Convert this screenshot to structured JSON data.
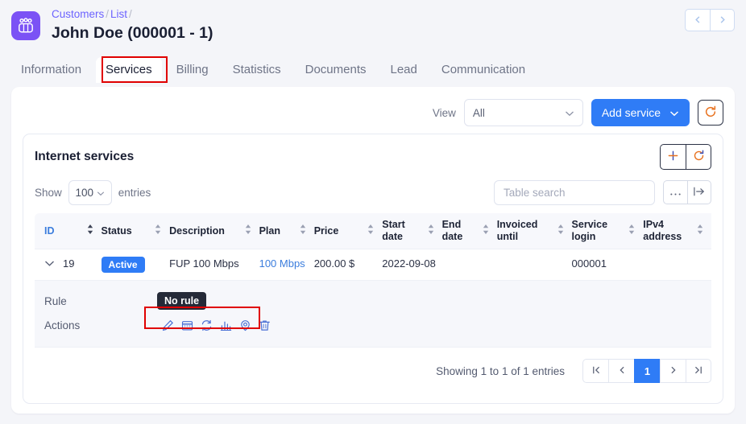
{
  "header": {
    "app_icon": "users-group-icon",
    "breadcrumb": [
      {
        "label": "Customers",
        "link": true
      },
      {
        "label": "List",
        "link": true
      }
    ],
    "title": "John Doe (000001 - 1)",
    "prev_icon": "chevron-left-icon",
    "next_icon": "chevron-right-icon"
  },
  "tabs": [
    {
      "label": "Information",
      "active": false
    },
    {
      "label": "Services",
      "active": true
    },
    {
      "label": "Billing",
      "active": false
    },
    {
      "label": "Statistics",
      "active": false
    },
    {
      "label": "Documents",
      "active": false
    },
    {
      "label": "Lead",
      "active": false
    },
    {
      "label": "Communication",
      "active": false
    }
  ],
  "toolbar": {
    "view_label": "View",
    "view_value": "All",
    "add_service_label": "Add service",
    "refresh_icon": "refresh-icon"
  },
  "panel": {
    "title": "Internet services",
    "add_icon": "plus-icon",
    "refresh_icon": "refresh-icon"
  },
  "table_controls": {
    "show_label": "Show",
    "entries_label": "entries",
    "page_length": "100",
    "search_placeholder": "Table search",
    "search_value": "",
    "more_icon": "ellipsis-icon",
    "export_icon": "export-arrow-icon"
  },
  "table": {
    "columns": [
      {
        "label": "ID",
        "sorted": true
      },
      {
        "label": "Status",
        "sorted": false
      },
      {
        "label": "Description",
        "sorted": false
      },
      {
        "label": "Plan",
        "sorted": false
      },
      {
        "label": "Price",
        "sorted": false
      },
      {
        "label": "Start date",
        "sorted": false
      },
      {
        "label": "End date",
        "sorted": false
      },
      {
        "label": "Invoiced until",
        "sorted": false
      },
      {
        "label": "Service login",
        "sorted": false
      },
      {
        "label": "IPv4 address",
        "sorted": false
      }
    ],
    "rows": [
      {
        "expand_icon": "chevron-down-icon",
        "id": "19",
        "status": "Active",
        "description": "FUP 100 Mbps",
        "plan": "100 Mbps",
        "price": "200.00 $",
        "start_date": "2022-09-08",
        "end_date": "",
        "invoiced_until": "",
        "service_login": "000001",
        "ipv4_address": ""
      }
    ],
    "detail": {
      "rule_label": "Rule",
      "rule_tooltip": "No rule",
      "actions_label": "Actions",
      "action_icons": [
        "edit-pencil-icon",
        "calendar-icon",
        "sync-icon",
        "bar-chart-icon",
        "location-pin-icon",
        "trash-icon"
      ]
    }
  },
  "footer": {
    "showing_text": "Showing 1 to 1 of 1 entries",
    "pager": [
      {
        "label": "|<",
        "name": "first",
        "active": false
      },
      {
        "label": "<",
        "name": "prev",
        "active": false
      },
      {
        "label": "1",
        "name": "page-1",
        "active": true
      },
      {
        "label": ">",
        "name": "next",
        "active": false
      },
      {
        "label": ">|",
        "name": "last",
        "active": false
      }
    ]
  },
  "colors": {
    "accent_blue": "#2f7cf6",
    "link_blue": "#3b7ddd",
    "brand_purple": "#7b52f5",
    "annotation_red": "#e00000",
    "page_bg": "#f4f5f9"
  }
}
